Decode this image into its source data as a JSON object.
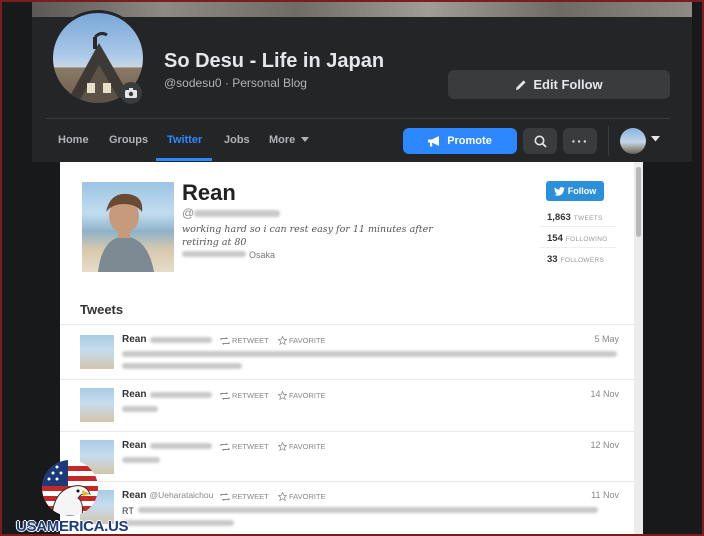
{
  "page": {
    "title": "So Desu - Life in Japan",
    "handle": "@sodesu0",
    "separator": "·",
    "category": "Personal Blog",
    "edit_follow_label": "Edit Follow"
  },
  "nav": {
    "tabs": [
      {
        "label": "Home"
      },
      {
        "label": "Groups"
      },
      {
        "label": "Twitter",
        "active": true
      },
      {
        "label": "Jobs"
      },
      {
        "label": "More"
      }
    ],
    "promote_label": "Promote",
    "more_dots": "···"
  },
  "twitter": {
    "name": "Rean",
    "handle_prefix": "@",
    "bio": "working hard so i can rest easy for 11 minutes after retiring at 80",
    "location": "Osaka",
    "follow_label": "Follow",
    "stats": [
      {
        "value": "1,863",
        "label": "TWEETS"
      },
      {
        "value": "154",
        "label": "FOLLOWING"
      },
      {
        "value": "33",
        "label": "FOLLOWERS"
      }
    ],
    "tweets_heading": "Tweets",
    "retweet_label": "RETWEET",
    "favorite_label": "FAVORITE",
    "tweets": [
      {
        "author": "Rean",
        "handle": "",
        "date": "5 May",
        "text": ""
      },
      {
        "author": "Rean",
        "handle": "",
        "date": "14 Nov",
        "text": ""
      },
      {
        "author": "Rean",
        "handle": "",
        "date": "12 Nov",
        "text": ""
      },
      {
        "author": "Rean",
        "handle": "@Ueharataichou",
        "date": "11 Nov",
        "text": "RT"
      }
    ]
  },
  "watermark": {
    "text": "USAMERICA.US"
  },
  "colors": {
    "accent": "#2d88ff",
    "twitter_blue": "#2b90d9",
    "header_bg": "#242526",
    "page_bg": "#18191a"
  },
  "icons": [
    "camera-icon",
    "pencil-icon",
    "megaphone-icon",
    "search-icon",
    "caret-down-icon",
    "twitter-bird-icon",
    "retweet-icon",
    "star-icon"
  ]
}
